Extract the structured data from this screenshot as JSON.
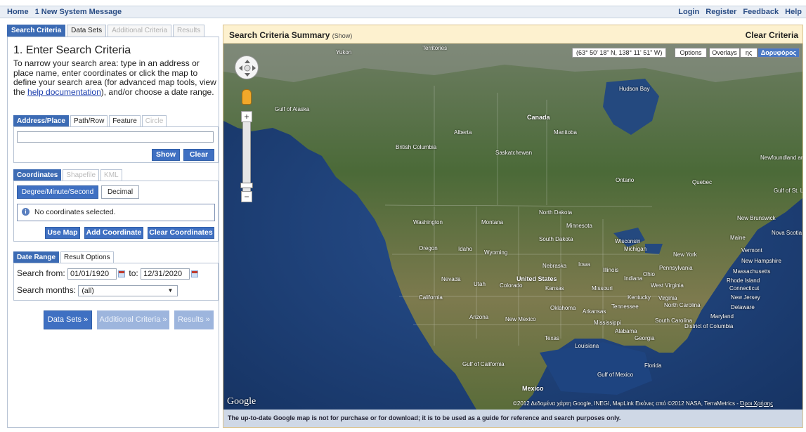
{
  "topnav": {
    "home": "Home",
    "message": "1 New System Message",
    "login": "Login",
    "register": "Register",
    "feedback": "Feedback",
    "help": "Help"
  },
  "main_tabs": [
    "Search Criteria",
    "Data Sets",
    "Additional Criteria",
    "Results"
  ],
  "search": {
    "heading": "1. Enter Search Criteria",
    "intro_before": "To narrow your search area: type in an address or place name, enter coordinates or click the map to define your search area (for advanced map tools, view the ",
    "intro_link": "help documentation",
    "intro_after": "), and/or choose a date range."
  },
  "address_tabs": [
    "Address/Place",
    "Path/Row",
    "Feature",
    "Circle"
  ],
  "address": {
    "value": "",
    "show": "Show",
    "clear": "Clear"
  },
  "coord_tabs": [
    "Coordinates",
    "Shapefile",
    "KML"
  ],
  "coords": {
    "formats": [
      "Degree/Minute/Second",
      "Decimal"
    ],
    "message": "No coordinates selected.",
    "use_map": "Use Map",
    "add": "Add Coordinate",
    "clear": "Clear Coordinates"
  },
  "date_tabs": [
    "Date Range",
    "Result Options"
  ],
  "date": {
    "from_label": "Search from:",
    "from": "01/01/1920",
    "to_label": "to:",
    "to": "12/31/2020",
    "months_label": "Search months:",
    "months": "(all)"
  },
  "nav_buttons": [
    "Data Sets »",
    "Additional Criteria »",
    "Results »"
  ],
  "map_panel": {
    "title": "Search Criteria Summary",
    "show": "(Show)",
    "clear": "Clear Criteria",
    "coordinate_readout": "(63° 50' 18\" N, 138° 11' 51\" W)",
    "controls": [
      "Options",
      "Overlays",
      "ης",
      "Δορυφόρος"
    ],
    "logo": "Google",
    "attribution": "©2012 Δεδομένα χάρτη Google, INEGI, MapLink Εικόνες από ©2012 NASA, TerraMetrics -",
    "terms": "Όροι Χρήσης",
    "disclaimer": "The up-to-date Google map is not for purchase or for download; it is to be used as a guide for reference and search purposes only."
  },
  "map_labels": {
    "canada": "Canada",
    "alaska": "Gulf of Alaska",
    "yukon": "Yukon",
    "territories": "Territories",
    "hudson": "Hudson Bay",
    "alberta": "Alberta",
    "bc": "British Columbia",
    "sask": "Saskatchewan",
    "manitoba": "Manitoba",
    "ontario": "Ontario",
    "quebec": "Quebec",
    "newfoundland": "Newfoundland and Labrador",
    "washington": "Washington",
    "montana": "Montana",
    "nd": "North Dakota",
    "minnesota": "Minnesota",
    "oregon": "Oregon",
    "idaho": "Idaho",
    "wyoming": "Wyoming",
    "sd": "South Dakota",
    "wisconsin": "Wisconsin",
    "michigan": "Michigan",
    "newyork": "New York",
    "nevada": "Nevada",
    "utah": "Utah",
    "colorado": "Colorado",
    "us": "United States",
    "nebraska": "Nebraska",
    "iowa": "Iowa",
    "illinois": "Illinois",
    "indiana": "Indiana",
    "ohio": "Ohio",
    "penn": "Pennsylvania",
    "california": "California",
    "kansas": "Kansas",
    "missouri": "Missouri",
    "kentucky": "Kentucky",
    "virginia": "Virginia",
    "wv": "West Virginia",
    "arizona": "Arizona",
    "nm": "New Mexico",
    "oklahoma": "Oklahoma",
    "arkansas": "Arkansas",
    "tennessee": "Tennessee",
    "nc": "North Carolina",
    "sc": "South Carolina",
    "texas": "Texas",
    "mississippi": "Mississippi",
    "alabama": "Alabama",
    "georgia": "Georgia",
    "louisiana": "Louisiana",
    "florida": "Florida",
    "mexico": "Mexico",
    "gulfmexico": "Gulf of Mexico",
    "maine": "Maine",
    "novascotia": "Nova Scotia",
    "massachusetts": "Massachusetts",
    "nj": "New Jersey",
    "delaware": "Delaware",
    "maryland": "Maryland",
    "dc": "District of Columbia",
    "connecticut": "Connecticut",
    "rhode": "Rhode Island",
    "vermont": "Vermont",
    "nh": "New Hampshire",
    "gulfcal": "Gulf of California",
    "newbrunswick": "New Brunswick",
    "stlawrence": "Gulf of St. Lawrence"
  },
  "colors": {
    "accent": "#3f70c2",
    "tab_active": "#3c6bb4",
    "header_bg": "#fdf1cf",
    "ocean": "#1b3a6e",
    "land": "#4d6a3a"
  }
}
